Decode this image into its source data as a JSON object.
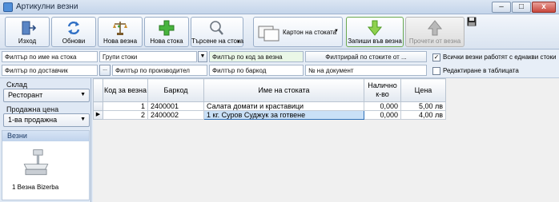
{
  "window": {
    "title": "Артикулни везни",
    "min": "–",
    "max": "□",
    "close": "x"
  },
  "toolbar": {
    "buttons": [
      {
        "label": "Изход",
        "icon": "exit-door-icon"
      },
      {
        "label": "Обнови",
        "icon": "refresh-icon"
      },
      {
        "label": "Нова везна",
        "icon": "scale-icon"
      },
      {
        "label": "Нова стока",
        "icon": "plus-icon"
      },
      {
        "label": "Търсене на стока",
        "icon": "magnifier-icon"
      },
      {
        "label": "Картон на стоката",
        "icon": "cards-icon"
      },
      {
        "label": "Запиши във везна",
        "icon": "arrow-down-icon"
      },
      {
        "label": "Прочети от везна",
        "icon": "arrow-up-icon"
      }
    ],
    "save_icon": "floppy-disk-icon"
  },
  "filters": {
    "name_filter": "Филтър по име на стока",
    "groups": "Групи стоки",
    "scale_code_filter": "Филтър по код за везна",
    "filter_by_goods_btn": "Филтрирай по стоките от ...",
    "supplier_filter": "Филтър по доставчик",
    "producer_filter": "Филтър по производител",
    "barcode_filter": "Филтър по баркод",
    "document_no": "№ на документ",
    "all_scales_same_label": "Всички везни работят с еднакви стоки",
    "all_scales_same_checked": true,
    "edit_in_table_label": "Редактиране в таблицата",
    "edit_in_table_checked": false
  },
  "left": {
    "warehouse_label": "Склад",
    "warehouse_value": "Ресторант",
    "price_label": "Продажна цена",
    "price_value": "1-ва продажна",
    "scales_header": "Везни",
    "scale_item": "1 Везна Bizerba"
  },
  "grid": {
    "headers": [
      "Код за везна",
      "Баркод",
      "Име на стоката",
      "Налично к-во",
      "Цена"
    ],
    "rows": [
      {
        "code": "1",
        "barcode": "2400001",
        "name": "Салата домати и краставици",
        "qty": "0,000",
        "price": "5,00 лв"
      },
      {
        "code": "2",
        "barcode": "2400002",
        "name": "1 кг. Суров Суджук за готвене",
        "qty": "0,000",
        "price": "4,00 лв"
      }
    ],
    "current_row_marker": "▶"
  },
  "colors": {
    "accent": "#2f6fb6",
    "green_frame": "#6aa84f"
  }
}
